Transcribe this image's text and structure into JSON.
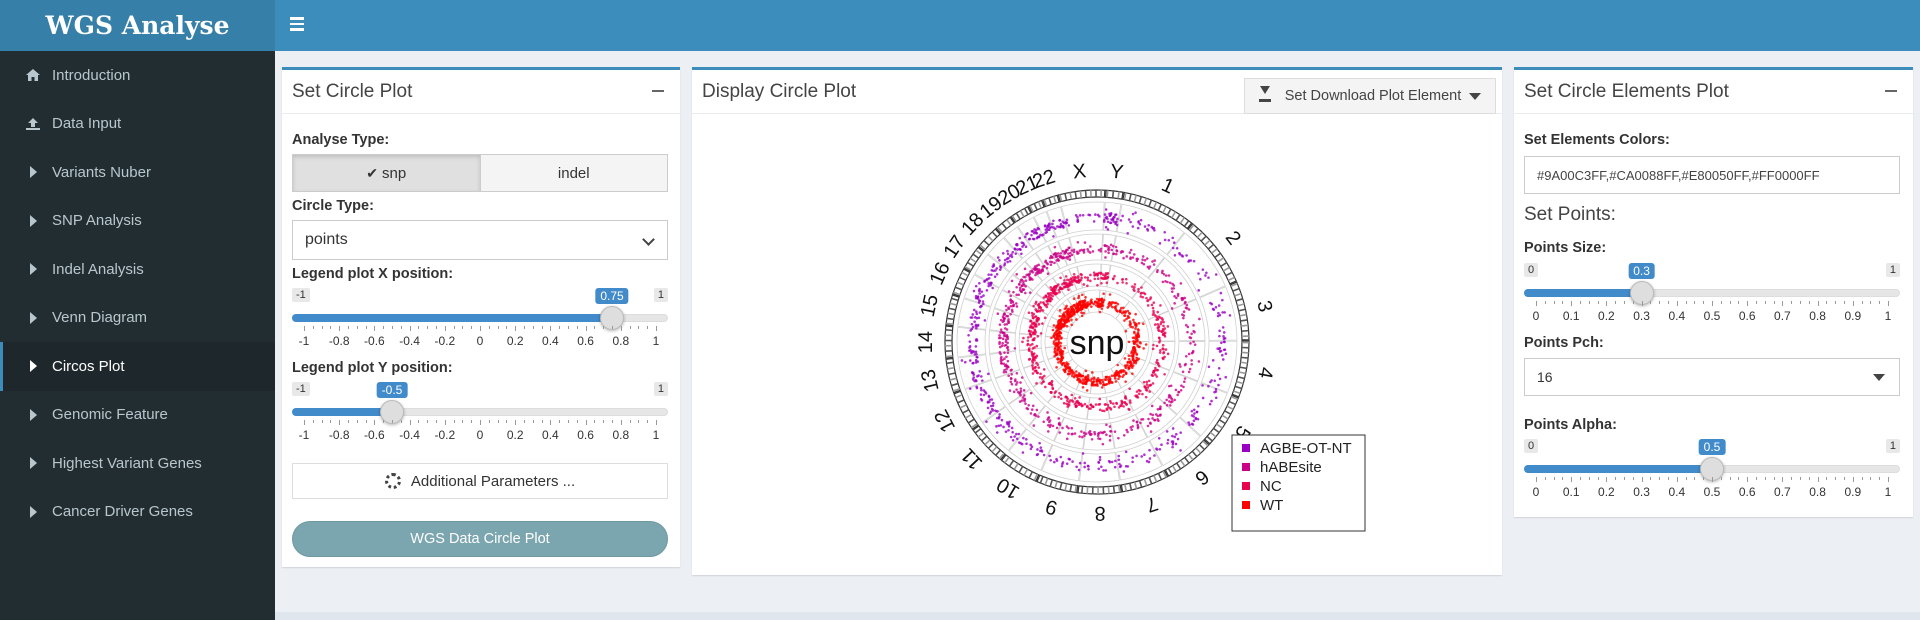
{
  "app": {
    "title": "WGS Analyse"
  },
  "sidebar": {
    "items": [
      {
        "label": "Introduction",
        "icon": "home-icon"
      },
      {
        "label": "Data Input",
        "icon": "upload-icon"
      },
      {
        "label": "Variants Nuber",
        "icon": "caret-right-icon"
      },
      {
        "label": "SNP Analysis",
        "icon": "caret-right-icon"
      },
      {
        "label": "Indel Analysis",
        "icon": "caret-right-icon"
      },
      {
        "label": "Venn Diagram",
        "icon": "caret-right-icon"
      },
      {
        "label": "Circos Plot",
        "icon": "caret-right-icon",
        "active": true
      },
      {
        "label": "Genomic Feature",
        "icon": "caret-right-icon"
      },
      {
        "label": "Highest Variant Genes",
        "icon": "caret-right-icon"
      },
      {
        "label": "Cancer Driver Genes",
        "icon": "caret-right-icon"
      }
    ]
  },
  "left_panel": {
    "title": "Set Circle Plot",
    "analyse_type_label": "Analyse Type:",
    "analyse_options": [
      "snp",
      "indel"
    ],
    "analyse_selected": "snp",
    "circle_type_label": "Circle Type:",
    "circle_type_value": "points",
    "legend_x": {
      "label": "Legend plot X position:",
      "min": "-1",
      "max": "1",
      "value": "0.75",
      "fraction": 0.875,
      "ticks": [
        "-1",
        "-0.8",
        "-0.6",
        "-0.4",
        "-0.2",
        "0",
        "0.2",
        "0.4",
        "0.6",
        "0.8",
        "1"
      ]
    },
    "legend_y": {
      "label": "Legend plot Y position:",
      "min": "-1",
      "max": "1",
      "value": "-0.5",
      "fraction": 0.25,
      "ticks": [
        "-1",
        "-0.8",
        "-0.6",
        "-0.4",
        "-0.2",
        "0",
        "0.2",
        "0.4",
        "0.6",
        "0.8",
        "1"
      ]
    },
    "additional_params_label": "Additional Parameters ...",
    "run_button_label": "WGS Data Circle Plot"
  },
  "middle_panel": {
    "title": "Display Circle Plot",
    "download_label": "Set Download Plot Element",
    "plot": {
      "center_label": "snp",
      "chromosomes": [
        "1",
        "2",
        "3",
        "4",
        "5",
        "6",
        "7",
        "8",
        "9",
        "10",
        "11",
        "12",
        "13",
        "14",
        "15",
        "16",
        "17",
        "18",
        "19",
        "20",
        "21",
        "22",
        "X",
        "Y"
      ],
      "legend": [
        {
          "name": "AGBE-OT-NT",
          "color": "#9A00C3"
        },
        {
          "name": "hABEsite",
          "color": "#CA0088"
        },
        {
          "name": "NC",
          "color": "#E80050"
        },
        {
          "name": "WT",
          "color": "#FF0000"
        }
      ]
    }
  },
  "right_panel": {
    "title": "Set Circle Elements Plot",
    "colors_label": "Set Elements Colors:",
    "colors_value": "#9A00C3FF,#CA0088FF,#E80050FF,#FF0000FF",
    "points_heading": "Set Points:",
    "points_size": {
      "label": "Points Size:",
      "min": "0",
      "max": "1",
      "value": "0.3",
      "fraction": 0.3,
      "ticks": [
        "0",
        "0.1",
        "0.2",
        "0.3",
        "0.4",
        "0.5",
        "0.6",
        "0.7",
        "0.8",
        "0.9",
        "1"
      ]
    },
    "points_pch": {
      "label": "Points Pch:",
      "value": "16"
    },
    "points_alpha": {
      "label": "Points Alpha:",
      "min": "0",
      "max": "1",
      "value": "0.5",
      "fraction": 0.5,
      "ticks": [
        "0",
        "0.1",
        "0.2",
        "0.3",
        "0.4",
        "0.5",
        "0.6",
        "0.7",
        "0.8",
        "0.9",
        "1"
      ]
    }
  }
}
